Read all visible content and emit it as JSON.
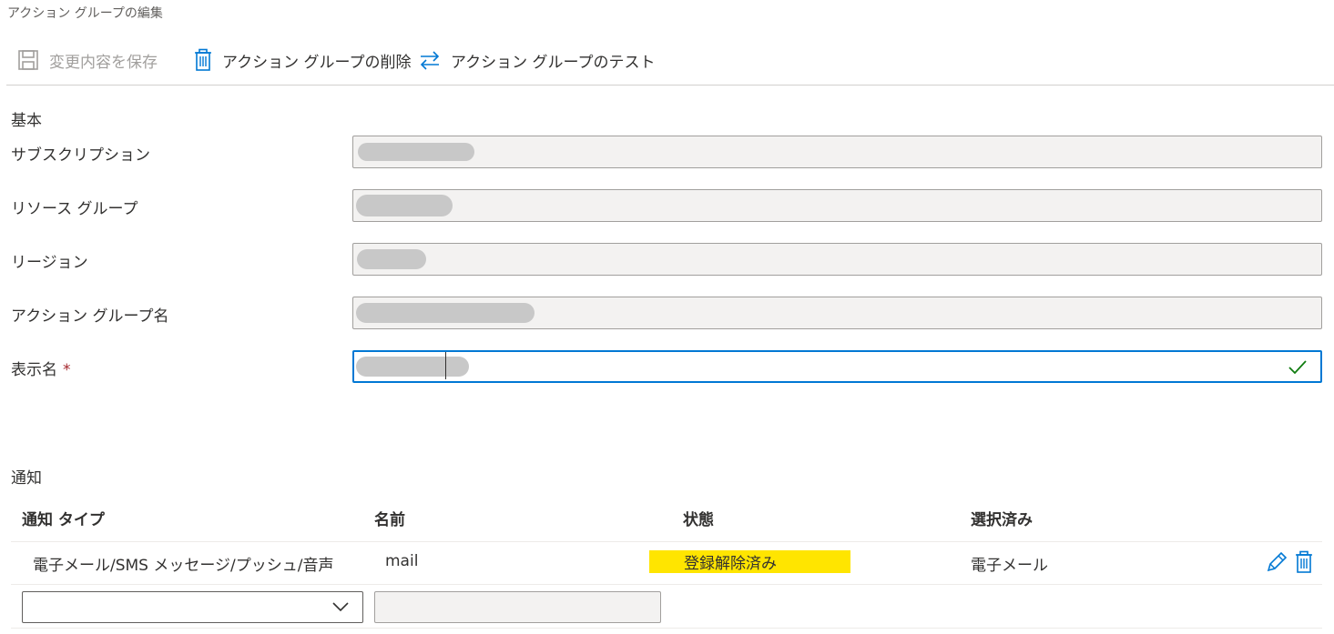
{
  "breadcrumb": "アクション グループの編集",
  "toolbar": {
    "save_label": "変更内容を保存",
    "delete_label": "アクション グループの削除",
    "test_label": "アクション グループのテスト"
  },
  "basics": {
    "title": "基本",
    "subscription_label": "サブスクリプション",
    "resource_group_label": "リソース グループ",
    "region_label": "リージョン",
    "action_group_name_label": "アクション グループ名",
    "display_name_label": "表示名",
    "required_marker": "*"
  },
  "notifications": {
    "title": "通知",
    "columns": [
      "通知 タイプ",
      "名前",
      "状態",
      "選択済み"
    ],
    "rows": [
      {
        "type": "電子メール/SMS メッセージ/プッシュ/音声",
        "name": "mail",
        "status": "登録解除済み",
        "selected": "電子メール"
      }
    ],
    "new_row": {
      "type_value": "",
      "name_value": ""
    }
  },
  "colors": {
    "accent": "#0078d4",
    "status_highlight": "#ffe500",
    "valid_check": "#107c10",
    "required": "#a4262c"
  },
  "icons": {
    "save": "save-icon",
    "delete": "trash-icon",
    "test": "swap-arrows-icon",
    "valid": "checkmark-icon",
    "edit": "pencil-icon",
    "row_delete": "trash-icon",
    "dropdown": "chevron-down-icon"
  }
}
